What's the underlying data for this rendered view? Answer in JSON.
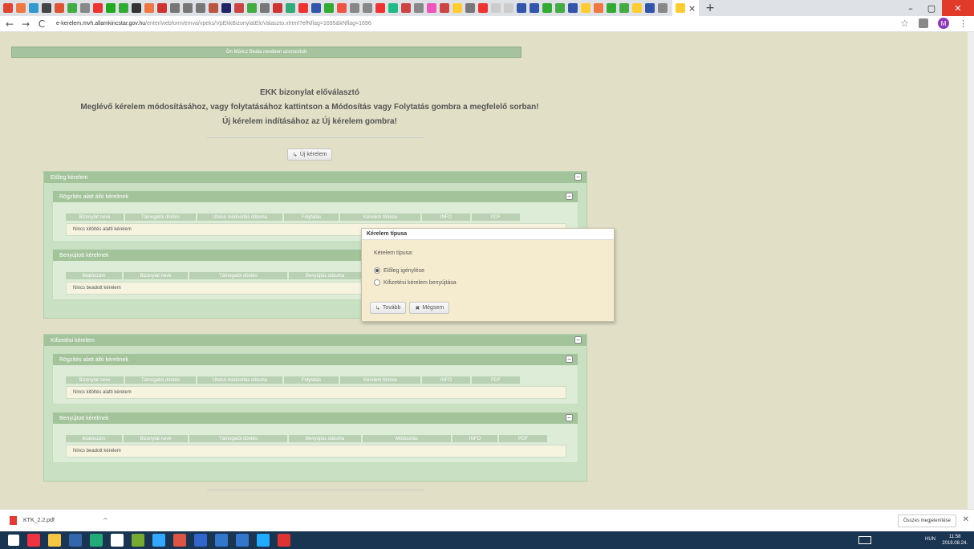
{
  "browser": {
    "tab_close_glyph": "×",
    "new_tab_glyph": "+",
    "url_host": "e-kerelem.mvh.allamkincstar.gov.hu",
    "url_path": "/enter/webform/emva/vpeks/VpEkkBizonylatEloValaszto.xhtml?efNflag=1695&kNflag=1696",
    "back_glyph": "←",
    "forward_glyph": "→",
    "reload_glyph": "C",
    "lock_glyph": "🔒",
    "star_glyph": "☆",
    "avatar_letter": "M",
    "menu_glyph": "⋮",
    "win_min": "–",
    "win_max": "▢",
    "win_close": "✕"
  },
  "page": {
    "user_bar": "Ön Móricz Beáta nevében azonosított",
    "heading_1": "EKK bizonylat előválasztó",
    "heading_2": "Meglévő kérelem módosításához, vagy folytatásához kattintson a Módosítás vagy Folytatás gombra a megfelelő sorban!",
    "heading_3": "Új kérelem indításához az Új kérelem gombra!",
    "new_request_button": "Új kérelem",
    "btn_arrow": "↳"
  },
  "panel1": {
    "title": "Előleg kérelem",
    "sub1": {
      "title": "Rögzítés alatt álló kérelmek",
      "columns": [
        "Bizonylat neve",
        "Támogatói döntés",
        "Utolsó módosítás dátuma",
        "Folytatás",
        "Kérelem törlése",
        "INFO",
        "PDF"
      ],
      "empty": "Nincs kitöltés alatti kérelem"
    },
    "sub2": {
      "title": "Benyújtott kérelmek",
      "columns": [
        "Iktatószám",
        "Bizonylat neve",
        "Támogatói döntés",
        "Benyújtás dátuma"
      ],
      "empty": "Nincs beadott kérelem"
    }
  },
  "panel2": {
    "title": "Kifizetési kérelem",
    "sub1": {
      "title": "Rögzítés alatt álló kérelmek",
      "columns": [
        "Bizonylat neve",
        "Támogatói döntés",
        "Utolsó módosítás dátuma",
        "Folytatás",
        "Kérelem törlése",
        "INFO",
        "PDF"
      ],
      "empty": "Nincs kitöltés alatti kérelem"
    },
    "sub2": {
      "title": "Benyújtott kérelmek",
      "columns": [
        "Iktatószám",
        "Bizonylat neve",
        "Támogatói döntés",
        "Benyújtás dátuma",
        "Módosítás",
        "INFO",
        "PDF"
      ],
      "empty": "Nincs beadott kérelem"
    }
  },
  "dialog": {
    "title": "Kérelem típusa",
    "label": "Kérelem típusa:",
    "option_1": "Előleg igénylése",
    "option_2": "Kifizetési kérelem benyújtása",
    "selected": "Előleg igénylése",
    "next_button": "Tovább",
    "cancel_button": "Mégsem",
    "next_glyph": "↳",
    "cancel_glyph": "✖"
  },
  "downloads": {
    "file_name": "KTK_2.2.pdf",
    "caret": "^",
    "show_all": "Összes megjelenítése",
    "close_glyph": "✕"
  },
  "taskbar": {
    "tray_text": "HUN",
    "time": "11:58",
    "date": "2019.08.24."
  },
  "colors": {
    "page_bg": "#e1dfc6",
    "panel_header": "#a3c49a",
    "dialog_bg": "#f5eccf",
    "taskbar": "#1a3552"
  }
}
